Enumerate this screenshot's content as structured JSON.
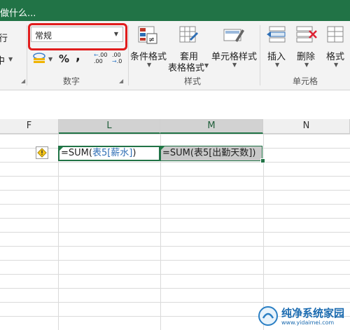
{
  "titlebar": {
    "tell_me": "做什么..."
  },
  "ribbon": {
    "number_format_value": "常规",
    "partial_left_top": "行",
    "partial_left_mid": "中",
    "number_symbols": {
      "percent": "%",
      "comma": ",",
      "inc_decimals": ".00",
      "dec_decimals": ".00"
    },
    "groups": {
      "number": "数字",
      "styles": "样式",
      "cells": "单元格"
    },
    "buttons": {
      "conditional_format": "条件格式",
      "format_as_table_1": "套用",
      "format_as_table_2": "表格格式",
      "cell_styles": "单元格样式",
      "insert": "插入",
      "delete": "删除",
      "format": "格式"
    }
  },
  "columns": [
    "F",
    "L",
    "M",
    "N"
  ],
  "cells": {
    "L_prefix": "=SUM(",
    "L_ref": "表5[薪水]",
    "L_suffix": ")",
    "M_prefix": "=SUM(",
    "M_ref": "表5[出勤天数]",
    "M_suffix": ")"
  },
  "watermark": {
    "title": "纯净系统家园",
    "url": "www.yidaimei.com"
  },
  "colors": {
    "excel_green": "#217346",
    "highlight_red": "#e11d1d",
    "formula_ref_blue": "#2e6eb5"
  },
  "icons": [
    "warning-diamond-icon",
    "conditional-format-icon",
    "table-format-icon",
    "cell-style-icon",
    "insert-cells-icon",
    "delete-cells-icon",
    "format-cells-icon"
  ]
}
